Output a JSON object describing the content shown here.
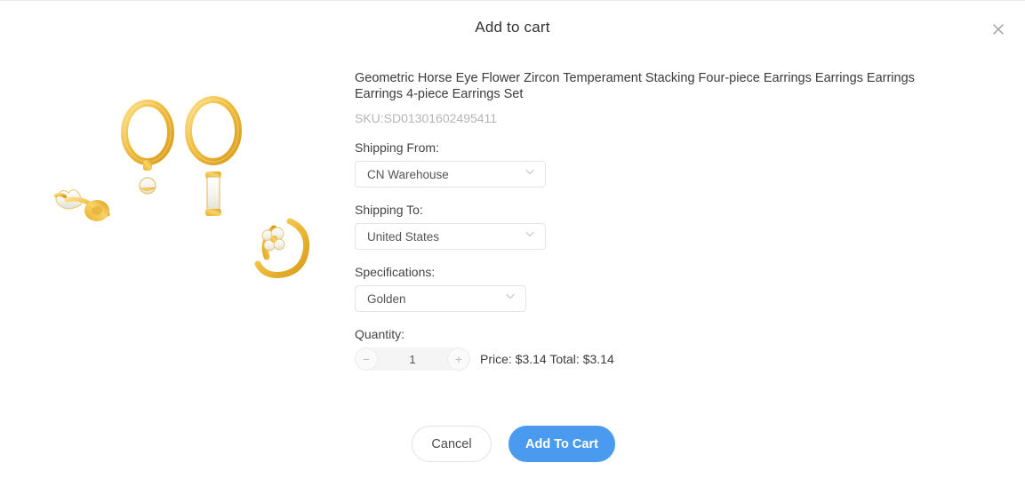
{
  "modal": {
    "title": "Add to cart",
    "close_icon": "close-icon"
  },
  "product": {
    "title": "Geometric Horse Eye Flower Zircon Temperament Stacking Four-piece Earrings Earrings Earrings Earrings 4-piece Earrings Set",
    "sku": "SKU:SD01301602495411",
    "image_alt": "four-gold-earrings-set"
  },
  "fields": {
    "shipping_from": {
      "label": "Shipping From:",
      "value": "CN Warehouse",
      "icon": "chevron-down-icon"
    },
    "shipping_to": {
      "label": "Shipping To:",
      "value": "United States",
      "icon": "chevron-down-icon"
    },
    "specifications": {
      "label": "Specifications:",
      "value": "Golden",
      "icon": "chevron-down-icon"
    },
    "quantity": {
      "label": "Quantity:",
      "value": "1",
      "decrement": "−",
      "increment": "+",
      "price_text": "Price: $3.14 Total: $3.14"
    }
  },
  "actions": {
    "cancel_label": "Cancel",
    "add_to_cart_label": "Add To Cart"
  },
  "colors": {
    "primary": "#4a9bf0",
    "border": "#e4e4e4",
    "muted_text": "#b5b5b5"
  }
}
